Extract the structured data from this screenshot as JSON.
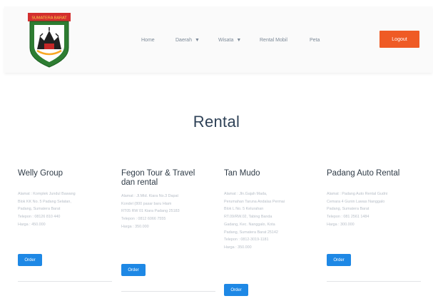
{
  "colors": {
    "accent": "#ef5b25",
    "order_button": "#1e88e5",
    "heading": "#2f4257"
  },
  "logo": {
    "banner_text": "SUMATERA BARAT",
    "icon": "west-sumatra-crest-icon"
  },
  "nav": {
    "home": "Home",
    "daerah": "Daerah",
    "wisata": "Wisata",
    "rental_mobil": "Rental Mobil",
    "peta": "Peta",
    "login": "Logout"
  },
  "page_title": "Rental",
  "order_label": "Order",
  "cards": [
    {
      "name": "Welly Group",
      "desc": [
        "Alamat : Komplek Jundul Bawang",
        "Blok KK No. 5 Padang Selatan,",
        "Padang, Sumatera Barat",
        "Telepon : 08126 810 440",
        "Harga : 450.000"
      ]
    },
    {
      "name": "Fegon Tour & Travel dan rental",
      "desc": [
        "Alamat : Jl.Mtd. Kiara No.3 Dapat",
        "Kondel (800 pasar baru Hiam",
        "RT05 RW 01 Kiara Padang 25183",
        "Telepon : 0812 6066 7555",
        "Harga : 350.000"
      ]
    },
    {
      "name": "Tan Mudo",
      "desc": [
        "Alamat : Jln.Gajah Mada,",
        "Perumahan Taruna Andalas Permai",
        "Blok L No. 5 Kelurahan",
        "RT.09/RW.02, Tabing Banda",
        "Gadang, Kec. Nanggalo, Kota",
        "Padang, Sumatera Barat 25142",
        "Telepon : 0812-3019-1181",
        "Harga : 350.000"
      ]
    },
    {
      "name": "Padang Auto Rental",
      "desc": [
        "Alamat : Padang Auto Rental Gudni",
        "Cemara 4 Gunin Lawas Nanggalo",
        "Padang, Sumatera Barat",
        "Telepon : 081 2561 1484",
        "Harga : 300.000"
      ]
    }
  ]
}
